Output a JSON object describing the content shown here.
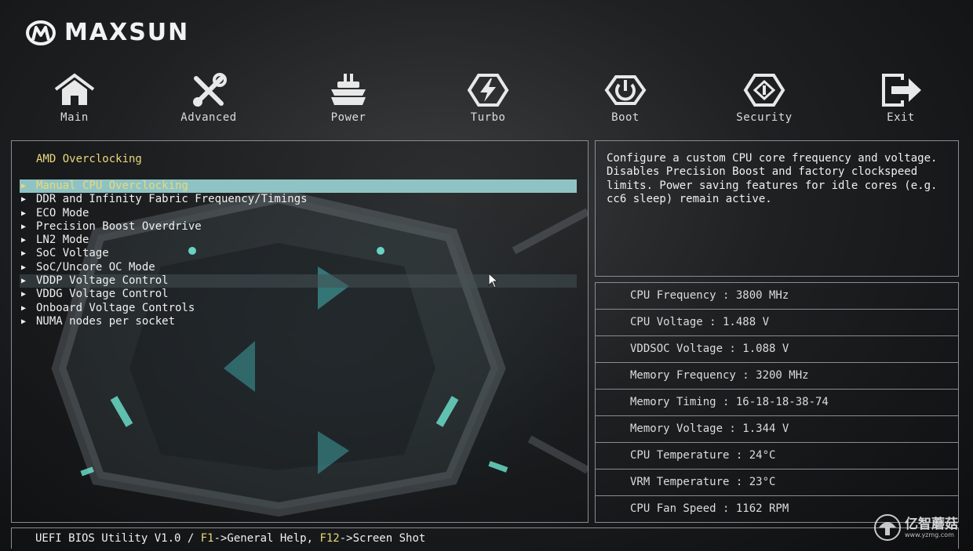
{
  "brand": {
    "name": "MAXSUN"
  },
  "nav": [
    {
      "label": "Main",
      "icon": "home-icon"
    },
    {
      "label": "Advanced",
      "icon": "tools-icon"
    },
    {
      "label": "Power",
      "icon": "power-supply-icon"
    },
    {
      "label": "Turbo",
      "icon": "lightning-icon"
    },
    {
      "label": "Boot",
      "icon": "power-button-icon"
    },
    {
      "label": "Security",
      "icon": "shield-icon"
    },
    {
      "label": "Exit",
      "icon": "exit-icon"
    }
  ],
  "section_title": "AMD Overclocking",
  "menu": [
    "Manual CPU Overclocking",
    "DDR and Infinity Fabric Frequency/Timings",
    "ECO Mode",
    "Precision Boost Overdrive",
    "LN2 Mode",
    "SoC Voltage",
    "SoC/Uncore OC Mode",
    "VDDP Voltage Control",
    "VDDG Voltage Control",
    "Onboard Voltage Controls",
    "NUMA nodes per socket"
  ],
  "help_text": "Configure a custom CPU core frequency and voltage. Disables Precision Boost and factory clockspeed limits. Power saving features for idle cores (e.g. cc6 sleep) remain active.",
  "stats": [
    "CPU Frequency : 3800 MHz",
    "CPU Voltage : 1.488 V",
    "VDDSOC Voltage : 1.088 V",
    "Memory Frequency : 3200 MHz",
    "Memory Timing : 16-18-18-38-74",
    "Memory Voltage : 1.344 V",
    "CPU Temperature : 24°C",
    "VRM Temperature : 23°C",
    "CPU Fan Speed : 1162 RPM"
  ],
  "footer": {
    "prefix": "UEFI BIOS Utility V1.0 / ",
    "f1": "F1",
    "f1_text": "->General Help, ",
    "f12": "F12",
    "f12_text": "->Screen Shot"
  },
  "watermark": {
    "title": "亿智蘑菇",
    "url": "www.yzmg.com"
  },
  "colors": {
    "highlight": "#8fc3c3",
    "accent_text": "#e9d87a",
    "border": "#8a8d90"
  }
}
